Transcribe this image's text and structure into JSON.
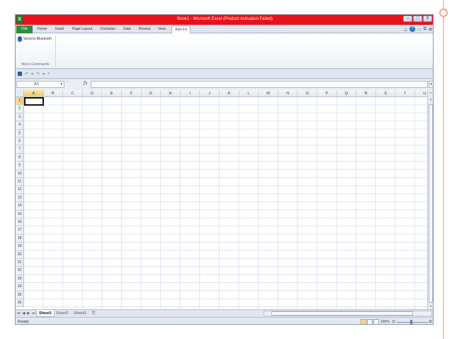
{
  "window": {
    "app_icon": "X",
    "title": "Book1 - Microsoft Excel (Product Activation Failed)",
    "buttons": [
      "—",
      "□",
      "✕"
    ]
  },
  "ribbon_tabs": {
    "file": "File",
    "tabs": [
      "Home",
      "Insert",
      "Page Layout",
      "Formulas",
      "Data",
      "Review",
      "View",
      "Add-Ins"
    ],
    "active": "Add-Ins"
  },
  "ribbon": {
    "command": "Send to Bluetooth",
    "group_label": "Menu Commands"
  },
  "formula_bar": {
    "name_box": "A1",
    "fx": "fx",
    "value": ""
  },
  "columns": [
    "A",
    "B",
    "C",
    "D",
    "E",
    "F",
    "G",
    "H",
    "I",
    "J",
    "K",
    "L",
    "M",
    "N",
    "O",
    "P",
    "Q",
    "R",
    "S",
    "T",
    "U"
  ],
  "rows": [
    "1",
    "2",
    "3",
    "4",
    "5",
    "6",
    "7",
    "8",
    "9",
    "10",
    "11",
    "12",
    "13",
    "14",
    "15",
    "16",
    "17",
    "18",
    "19",
    "20",
    "21",
    "22",
    "23",
    "24",
    "25",
    "26"
  ],
  "selected_cell": {
    "column": "A",
    "row": "1"
  },
  "sheets": {
    "tabs": [
      "Sheet1",
      "Sheet2",
      "Sheet3"
    ],
    "active": "Sheet1"
  },
  "status": {
    "ready": "Ready",
    "zoom": "100%"
  },
  "colors": {
    "titlebar": "#e8101a",
    "file_tab": "#2f8a3e",
    "selection": "#f7c867"
  }
}
